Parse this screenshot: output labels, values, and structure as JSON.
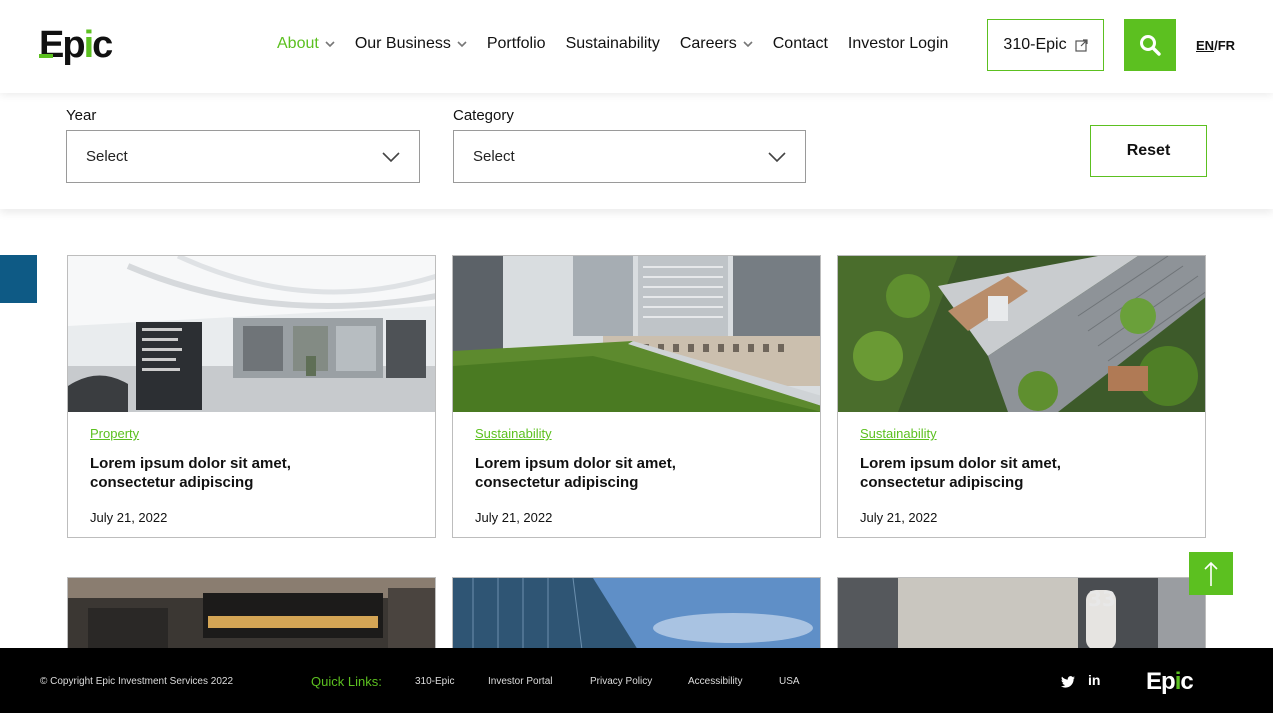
{
  "brand": {
    "logo_text": "Epic",
    "accent_color": "#5cc020"
  },
  "nav": {
    "items": [
      {
        "label": "About",
        "has_dropdown": true,
        "active": true
      },
      {
        "label": "Our Business",
        "has_dropdown": true
      },
      {
        "label": "Portfolio"
      },
      {
        "label": "Sustainability"
      },
      {
        "label": "Careers",
        "has_dropdown": true
      },
      {
        "label": "Contact"
      },
      {
        "label": "Investor Login"
      }
    ],
    "external_button": "310-Epic",
    "lang_en": "EN",
    "lang_sep": "/",
    "lang_fr": "FR"
  },
  "filters": {
    "year_label": "Year",
    "year_value": "Select",
    "category_label": "Category",
    "category_value": "Select",
    "reset_label": "Reset"
  },
  "cards": [
    {
      "category": "Property",
      "title": "Lorem ipsum dolor sit amet, consectetur adipiscing",
      "date": "July 21, 2022"
    },
    {
      "category": "Sustainability",
      "title": "Lorem ipsum dolor sit amet, consectetur adipiscing",
      "date": "July 21, 2022"
    },
    {
      "category": "Sustainability",
      "title": "Lorem ipsum dolor sit amet, consectetur adipiscing",
      "date": "July 21, 2022"
    }
  ],
  "footer": {
    "copyright": "© Copyright Epic Investment Services 2022",
    "quick_links_label": "Quick Links:",
    "links": [
      "310-Epic",
      "Investor Portal",
      "Privacy Policy",
      "Accessibility",
      "USA"
    ],
    "social": [
      "twitter-icon",
      "linkedin-icon"
    ],
    "linkedin_text": "in",
    "logo_text": "Epic"
  }
}
